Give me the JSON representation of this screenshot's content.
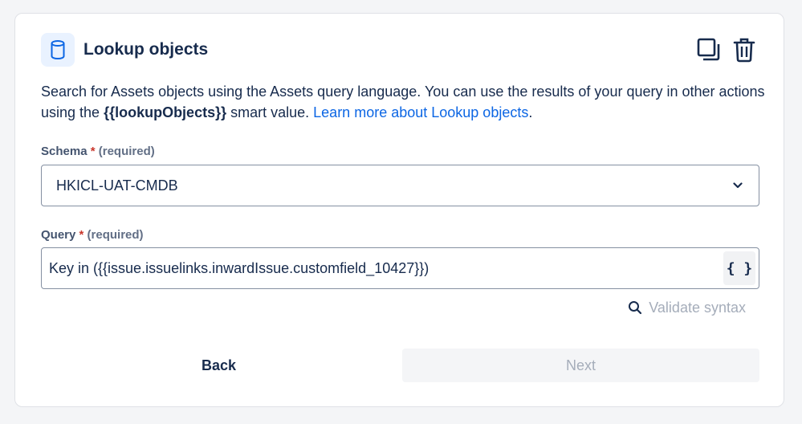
{
  "header": {
    "title": "Lookup objects",
    "icon": "database-icon",
    "actions": {
      "copy_icon": "copy-icon",
      "delete_icon": "trash-icon"
    }
  },
  "description": {
    "prefix": "Search for Assets objects using the Assets query language. You can use the results of your query in other actions using the ",
    "smart_value": "{{lookupObjects}}",
    "middle": " smart value. ",
    "link_text": "Learn more about Lookup objects",
    "suffix": "."
  },
  "schema": {
    "label": "Schema",
    "required_mark": "*",
    "required_text": "(required)",
    "value": "HKICL-UAT-CMDB"
  },
  "query": {
    "label": "Query",
    "required_mark": "*",
    "required_text": "(required)",
    "value": "Key in ({{issue.issuelinks.inwardIssue.customfield_10427}})",
    "smart_value_button": "{ }"
  },
  "validate": {
    "label": "Validate syntax"
  },
  "footer": {
    "back_label": "Back",
    "next_label": "Next"
  },
  "colors": {
    "link": "#0c66e4",
    "required": "#c9372c",
    "text": "#172b4d",
    "disabled_text": "#a5adba",
    "icon_bg": "#e9f2ff"
  }
}
